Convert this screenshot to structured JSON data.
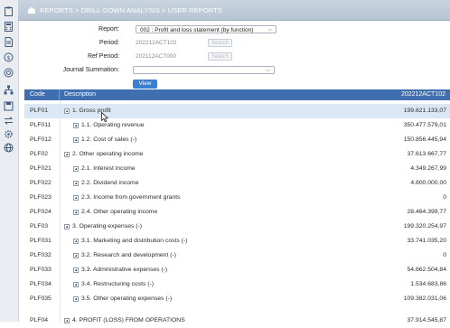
{
  "header": {
    "breadcrumb": "REPORTS > DRILL-DOWN ANALYSIS > USER REPORTS"
  },
  "sidebar": {
    "icons": [
      "clipboard-icon",
      "calculator-icon",
      "document-icon",
      "dollar-icon",
      "target-icon",
      "hierarchy-icon",
      "grid-icon",
      "save-icon",
      "exchange-icon",
      "settings-icon",
      "globe-icon"
    ]
  },
  "form": {
    "report_label": "Report:",
    "report_value": "002 : Profit and loss statement (by function)",
    "period_label": "Period:",
    "period_value": "202212ACT102",
    "period_search": "Search",
    "ref_period_label": "Ref Period:",
    "ref_period_value": "202112ACT000",
    "ref_search": "Search",
    "journal_label": "Journal Summation:",
    "journal_value": "",
    "view_button": "View"
  },
  "table": {
    "headers": {
      "code": "Code",
      "description": "Description",
      "amount": "202212ACT102"
    },
    "rows": [
      {
        "code": "PLF01",
        "description": "1. Gross profit",
        "amount": "199.621.133,07",
        "indent": 0
      },
      {
        "code": "PLF011",
        "description": "1.1. Operating revenue",
        "amount": "350.477.579,01",
        "indent": 1
      },
      {
        "code": "PLF012",
        "description": "1.2. Cost of sales (-)",
        "amount": "150.856.445,94",
        "indent": 1
      },
      {
        "code": "PLF02",
        "description": "2. Other operating income",
        "amount": "37.613.667,77",
        "indent": 0
      },
      {
        "code": "PLF021",
        "description": "2.1. Interest income",
        "amount": "4.349.267,99",
        "indent": 1
      },
      {
        "code": "PLF022",
        "description": "2.2. Dividend income",
        "amount": "4.800.000,00",
        "indent": 1
      },
      {
        "code": "PLF023",
        "description": "2.3. Income from government grants",
        "amount": "0",
        "indent": 1
      },
      {
        "code": "PLF024",
        "description": "2.4. Other operating income",
        "amount": "28.464.399,77",
        "indent": 1
      },
      {
        "code": "PLF03",
        "description": "3. Operating expenses (-)",
        "amount": "199.320.254,97",
        "indent": 0
      },
      {
        "code": "PLF031",
        "description": "3.1. Marketing and distribution costs (-)",
        "amount": "33.741.035,20",
        "indent": 1
      },
      {
        "code": "PLF032",
        "description": "3.2. Research and development (-)",
        "amount": "0",
        "indent": 1
      },
      {
        "code": "PLF033",
        "description": "3.3. Administrative expenses (-)",
        "amount": "54.662.504,84",
        "indent": 1
      },
      {
        "code": "PLF034",
        "description": "3.4. Restructuring costs (-)",
        "amount": "1.534.683,86",
        "indent": 1
      },
      {
        "code": "PLF035",
        "description": "3.5. Other operating expenses (-)",
        "amount": "109.382.031,06",
        "indent": 1
      },
      {
        "code": "PLF04",
        "description": "4. PROFIT (LOSS) FROM OPERATIONS",
        "amount": "37.914.545,87",
        "indent": 0
      }
    ]
  },
  "colors": {
    "header_bg": "#3f6fae",
    "selected_row": "#dbe7f5",
    "view_button": "#3b7fd0"
  }
}
